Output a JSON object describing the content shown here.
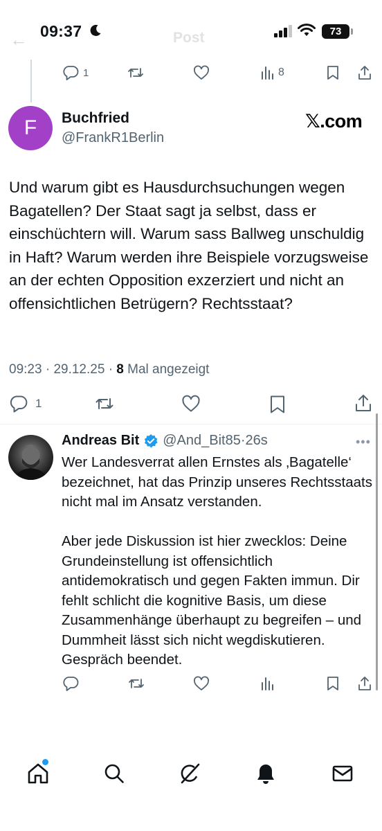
{
  "status_bar": {
    "time": "09:37",
    "battery": "73",
    "faded_title": "Post"
  },
  "top_actions": {
    "reply_count": "1",
    "views_count": "8"
  },
  "tweet": {
    "avatar_letter": "F",
    "author_name": "Buchfried",
    "author_handle": "@FrankR1Berlin",
    "brand": "𝕏.com",
    "text": "Und warum gibt es Hausdurchsuchungen wegen Bagatellen? Der Staat sagt ja selbst, dass er einschüchtern will. Warum sass Ballweg unschuldig in Haft? Warum werden ihre Beispiele vorzugsweise an der echten Opposition exzerziert und nicht an offensichtlichen Betrügern? Rechtsstaat?",
    "time": "09:23",
    "date": "29.12.25",
    "views": "8",
    "views_label": "Mal angezeigt",
    "reply_count": "1"
  },
  "reply": {
    "author_name": "Andreas Bit",
    "author_handle": "@And_Bit85",
    "age": "26s",
    "paragraph_1": "Wer Landesverrat allen Ernstes als ‚Bagatelle‘ bezeichnet, hat das Prinzip unseres Rechtsstaats nicht mal im Ansatz verstanden.",
    "paragraph_2": "Aber jede Diskussion ist hier zwecklos: Deine Grundeinstellung ist offensichtlich antidemokratisch und gegen Fakten immun. Dir fehlt schlicht die kognitive Basis, um diese Zusammenhänge überhaupt zu begreifen – und Dummheit lässt sich nicht wegdiskutieren. Gespräch beendet."
  },
  "icons": {
    "reply": "reply-icon",
    "repost": "repost-icon",
    "like": "like-icon",
    "views": "views-icon",
    "bookmark": "bookmark-icon",
    "share": "share-icon",
    "home": "home-icon",
    "search": "search-icon",
    "grok": "grok-icon",
    "notifications": "bell-icon",
    "messages": "mail-icon"
  },
  "colors": {
    "avatar_f": "#a241c7",
    "verified": "#1d9bf0",
    "muted_text": "#536471"
  }
}
